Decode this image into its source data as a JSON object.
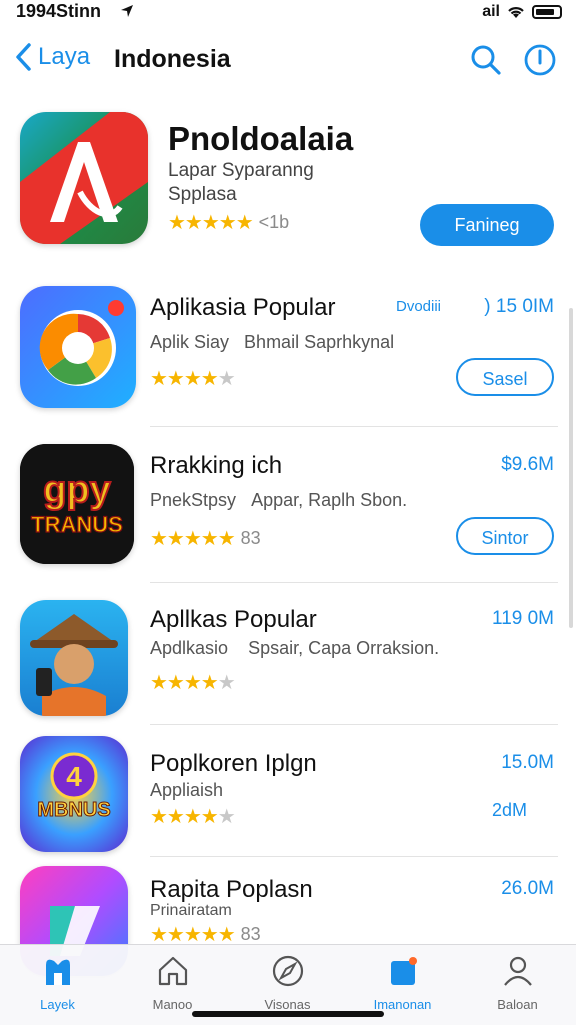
{
  "status": {
    "time": "1994Stinn",
    "signal": "ail",
    "wifi_icon": "wifi-icon",
    "battery_icon": "battery-icon"
  },
  "nav": {
    "back_label": "Laya",
    "title": "Indonesia",
    "search_icon": "search-icon",
    "info_icon": "info-icon"
  },
  "featured": {
    "title": "Pnoldoalaia",
    "subtitle1": "Lapar Syparanng",
    "subtitle2": "Spplasa",
    "rating_text": "★★★★★",
    "rating_count": "<1b",
    "button": "Fanineg"
  },
  "apps": [
    {
      "name": "Aplikasia Popular",
      "sub_left": "Aplik Siay",
      "sub_right": "Bhmail Saprhkynal",
      "extra": "Dvodiii",
      "price": ")  15 0IM",
      "stars": "★★★★",
      "stars_off": "★",
      "count": "",
      "button": "Sasel"
    },
    {
      "name": "Rrakking ich",
      "sub_left": "PnekStpsy",
      "sub_right": "Appar, Raplh Sbon.",
      "extra": "",
      "price": "$9.6M",
      "stars": "★★★★★",
      "stars_off": "",
      "count": "83",
      "button": "Sintor"
    },
    {
      "name": "Apllkas Popular",
      "sub_left": "Apdlkasio",
      "sub_right": "Spsair, Capa Orraksion.",
      "extra": "",
      "price": "119 0M",
      "stars": "★★★★",
      "stars_off": "★",
      "count": "",
      "button": ""
    },
    {
      "name": "Poplkoren Iplgn",
      "sub_left": "Appliaish",
      "sub_right": "",
      "extra": "2dM",
      "price": "15.0M",
      "stars": "★★★★",
      "stars_off": "★",
      "count": "",
      "button": ""
    },
    {
      "name": "Rapita Poplasn",
      "sub_left": "Prinairatam",
      "sub_right": "",
      "extra": "",
      "price": "26.0M",
      "stars": "★★★★★",
      "stars_off": "",
      "count": "83",
      "button": ""
    }
  ],
  "tabs": [
    {
      "label": "Layek",
      "icon": "today-icon"
    },
    {
      "label": "Manoo",
      "icon": "home-icon"
    },
    {
      "label": "Visonas",
      "icon": "compass-icon"
    },
    {
      "label": "Imanonan",
      "icon": "apps-icon"
    },
    {
      "label": "Baloan",
      "icon": "person-icon"
    }
  ],
  "colors": {
    "accent": "#1a8ee8",
    "star": "#f7b500"
  }
}
